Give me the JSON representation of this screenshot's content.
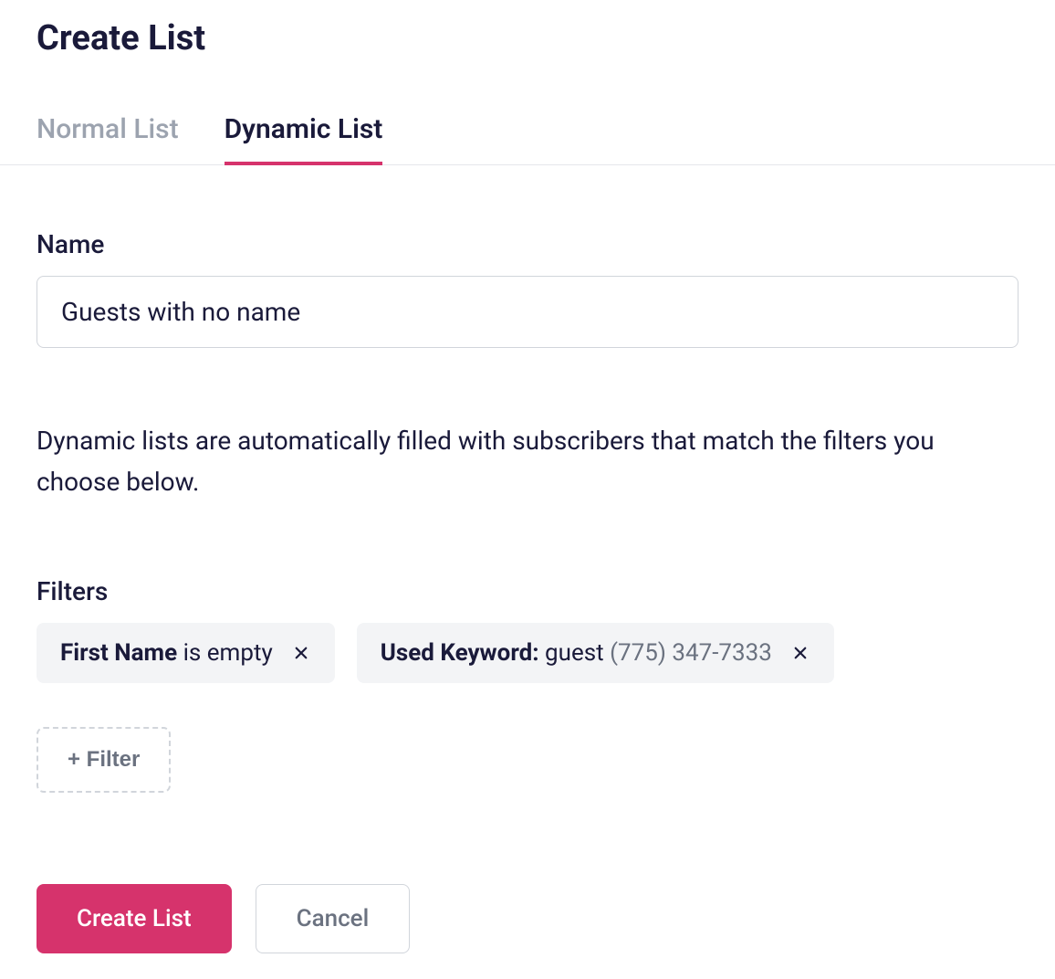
{
  "page": {
    "title": "Create List"
  },
  "tabs": [
    {
      "label": "Normal List",
      "active": false
    },
    {
      "label": "Dynamic List",
      "active": true
    }
  ],
  "form": {
    "name": {
      "label": "Name",
      "value": "Guests with no name"
    },
    "description": "Dynamic lists are automatically filled with subscribers that match the filters you choose below.",
    "filters": {
      "label": "Filters",
      "items": [
        {
          "field": "First Name",
          "condition": "is empty",
          "extra": ""
        },
        {
          "field": "Used Keyword:",
          "condition": "guest",
          "extra": "(775) 347-7333"
        }
      ],
      "add_label": "+ Filter"
    }
  },
  "actions": {
    "primary": "Create List",
    "secondary": "Cancel"
  }
}
